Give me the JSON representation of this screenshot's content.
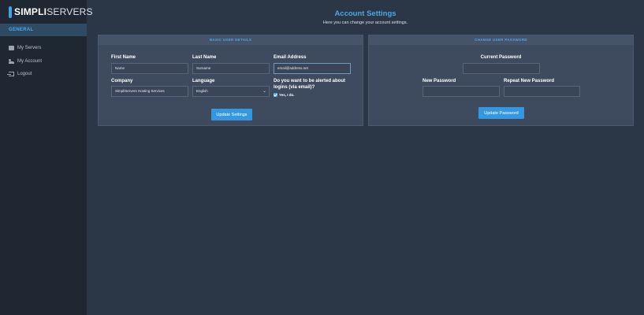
{
  "brand": {
    "bold": "SIMPLI",
    "light": "SERVERS"
  },
  "sidebar": {
    "section": "GENERAL",
    "items": [
      {
        "label": "My Servers",
        "icon": "servers-icon"
      },
      {
        "label": "My Account",
        "icon": "account-icon"
      },
      {
        "label": "Logout",
        "icon": "logout-icon"
      }
    ]
  },
  "page": {
    "title": "Account Settings",
    "subtitle": "Here you can change your account settings."
  },
  "user_details": {
    "header": "BASIC USER DETAILS",
    "first_name": {
      "label": "First Name",
      "value": "Name"
    },
    "last_name": {
      "label": "Last Name",
      "value": "Surname"
    },
    "email": {
      "label": "Email Address",
      "value": "email@address.net"
    },
    "company": {
      "label": "Company",
      "value": "SimpliServers Hosting Services"
    },
    "language": {
      "label": "Language",
      "value": "English"
    },
    "alerts": {
      "label_line1": "Do you want to be alerted about",
      "label_line2": "logins (via email)?",
      "checkbox_label": "Yes, I do."
    },
    "submit": "Update Settings"
  },
  "password": {
    "header": "CHANGE USER PASSWORD",
    "current": {
      "label": "Current Password",
      "value": ""
    },
    "new": {
      "label": "New Password",
      "value": ""
    },
    "repeat": {
      "label": "Repeat New Password",
      "value": ""
    },
    "submit": "Update Password"
  },
  "colors": {
    "accent": "#3fa2e6",
    "button": "#3497e0",
    "sidebar": "#1f2732",
    "background": "#2b3646",
    "panel": "#3e4b5e"
  }
}
